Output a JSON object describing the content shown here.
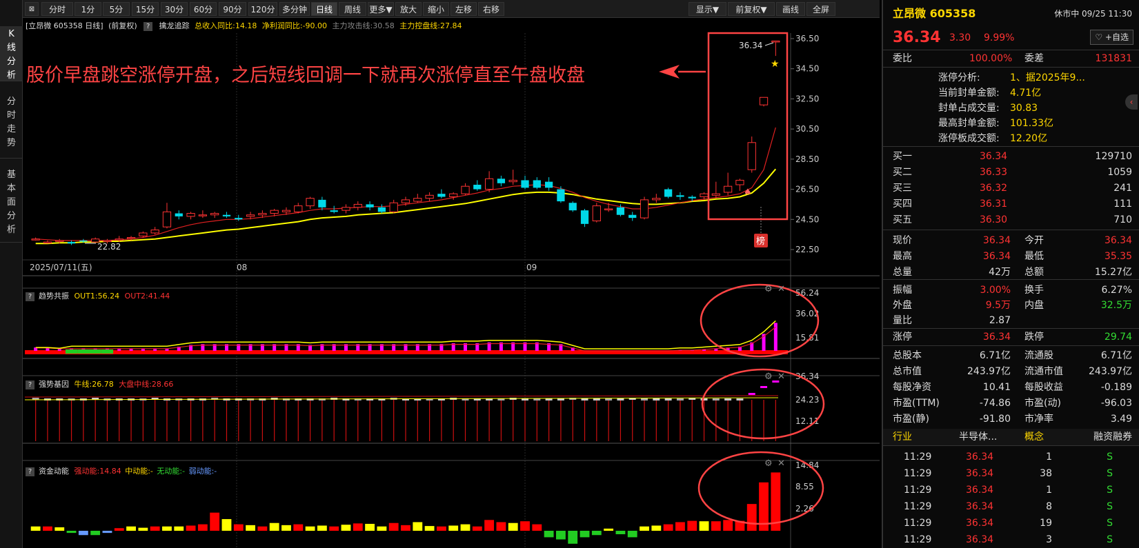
{
  "toolbar": {
    "buttons": [
      "分时",
      "1分",
      "5分",
      "15分",
      "30分",
      "60分",
      "90分",
      "120分",
      "多分钟",
      "日线",
      "周线",
      "更多▼",
      "放大",
      "缩小",
      "左移",
      "右移"
    ],
    "right_buttons": [
      "显示▼",
      "前复权▼",
      "画线",
      "全屏"
    ],
    "active": "日线"
  },
  "left_tabs": [
    "K\n线\n分\n析",
    "分\n时\n走\n势",
    "基\n本\n面\n分\n析"
  ],
  "info": {
    "symbol_tag": "[立昂微 605358 日线]",
    "adj": "(前复权)",
    "q": "?",
    "catch": "擒龙追踪",
    "income": "总收入同比:14.18",
    "profit": "净利润同比:-90.00",
    "attack": "主力攻击线:30.58",
    "control": "主力控盘线:27.84"
  },
  "chart": {
    "price_axis": [
      "36.50",
      "34.50",
      "32.50",
      "30.50",
      "28.50",
      "26.50",
      "24.50",
      "22.50"
    ],
    "dates": [
      "2025/07/11(五)",
      "08",
      "09"
    ],
    "low_label": "22.82",
    "high_label": "36.34",
    "annotation": "股价早盘跳空涨停开盘，之后短线回调一下就再次涨停直至午盘收盘",
    "bang": "榜"
  },
  "chart_data": {
    "type": "candlestick",
    "ylim": [
      22.0,
      37.0
    ],
    "ohlc": [
      [
        23.2,
        23.3,
        23.1,
        23.2
      ],
      [
        23.0,
        23.1,
        22.9,
        23.0
      ],
      [
        23.1,
        23.2,
        22.9,
        23.1
      ],
      [
        23.0,
        23.1,
        22.8,
        22.9
      ],
      [
        23.1,
        23.2,
        22.95,
        23.05
      ],
      [
        23.0,
        23.3,
        22.9,
        23.2
      ],
      [
        23.1,
        23.2,
        22.9,
        23.1
      ],
      [
        23.2,
        23.4,
        23.0,
        23.2
      ],
      [
        23.3,
        23.4,
        23.1,
        23.3
      ],
      [
        23.4,
        23.7,
        23.3,
        23.6
      ],
      [
        23.6,
        24.0,
        23.5,
        23.8
      ],
      [
        24.0,
        25.6,
        23.9,
        25.0
      ],
      [
        24.9,
        25.1,
        24.5,
        24.7
      ],
      [
        24.7,
        25.0,
        24.5,
        24.9
      ],
      [
        24.8,
        25.1,
        24.6,
        24.8
      ],
      [
        24.8,
        25.0,
        24.6,
        24.9
      ],
      [
        24.8,
        25.0,
        24.6,
        24.7
      ],
      [
        24.6,
        24.8,
        24.4,
        24.5
      ],
      [
        24.7,
        25.0,
        24.5,
        24.8
      ],
      [
        24.8,
        25.1,
        24.6,
        24.9
      ],
      [
        24.9,
        25.2,
        24.7,
        25.1
      ],
      [
        25.0,
        25.3,
        24.8,
        25.1
      ],
      [
        25.0,
        25.6,
        24.9,
        25.4
      ],
      [
        25.4,
        26.0,
        25.2,
        25.9
      ],
      [
        25.8,
        26.0,
        25.1,
        25.3
      ],
      [
        25.1,
        25.4,
        24.9,
        25.0
      ],
      [
        25.1,
        25.5,
        24.9,
        25.3
      ],
      [
        25.3,
        25.7,
        25.1,
        25.5
      ],
      [
        25.5,
        25.7,
        25.1,
        25.3
      ],
      [
        25.3,
        25.5,
        24.9,
        25.0
      ],
      [
        25.0,
        25.8,
        24.9,
        25.6
      ],
      [
        25.6,
        26.0,
        25.4,
        25.8
      ],
      [
        25.7,
        26.2,
        25.6,
        25.9
      ],
      [
        25.9,
        26.3,
        25.7,
        26.1
      ],
      [
        26.2,
        26.5,
        25.9,
        26.0
      ],
      [
        26.0,
        26.3,
        25.8,
        26.2
      ],
      [
        26.2,
        26.9,
        26.1,
        26.7
      ],
      [
        26.8,
        27.1,
        26.4,
        26.5
      ],
      [
        26.5,
        27.7,
        26.3,
        27.2
      ],
      [
        27.2,
        27.4,
        26.7,
        26.9
      ],
      [
        27.0,
        27.8,
        26.8,
        27.1
      ],
      [
        27.1,
        27.4,
        26.5,
        26.6
      ],
      [
        27.1,
        27.3,
        26.5,
        26.6
      ],
      [
        27.0,
        27.3,
        26.4,
        26.6
      ],
      [
        26.5,
        26.7,
        25.6,
        25.7
      ],
      [
        25.6,
        25.7,
        25.0,
        25.1
      ],
      [
        25.1,
        25.2,
        24.0,
        24.2
      ],
      [
        24.4,
        25.6,
        24.3,
        25.4
      ],
      [
        25.2,
        25.6,
        25.0,
        25.2
      ],
      [
        25.3,
        25.5,
        24.7,
        24.8
      ],
      [
        24.8,
        25.0,
        24.4,
        24.6
      ],
      [
        24.6,
        26.0,
        24.5,
        25.8
      ],
      [
        25.8,
        26.2,
        25.6,
        25.9
      ],
      [
        26.5,
        26.6,
        25.9,
        26.0
      ],
      [
        26.1,
        26.3,
        25.8,
        26.0
      ],
      [
        26.0,
        26.1,
        25.7,
        25.9
      ],
      [
        26.0,
        26.3,
        25.8,
        26.2
      ],
      [
        26.1,
        27.0,
        25.9,
        26.2
      ],
      [
        26.3,
        27.6,
        26.1,
        26.7
      ],
      [
        26.8,
        27.2,
        26.4,
        27.1
      ],
      [
        27.8,
        30.0,
        27.6,
        29.6
      ],
      [
        32.1,
        32.6,
        32.0,
        32.6
      ],
      [
        36.34,
        36.34,
        35.35,
        36.34
      ]
    ],
    "ma_short": [
      23.2,
      23.15,
      23.1,
      23.1,
      23.1,
      23.1,
      23.1,
      23.15,
      23.2,
      23.3,
      23.45,
      23.7,
      23.95,
      24.15,
      24.3,
      24.4,
      24.5,
      24.5,
      24.55,
      24.65,
      24.75,
      24.85,
      24.95,
      25.1,
      25.2,
      25.2,
      25.25,
      25.3,
      25.35,
      25.35,
      25.4,
      25.5,
      25.6,
      25.7,
      25.8,
      25.95,
      26.1,
      26.25,
      26.45,
      26.55,
      26.7,
      26.75,
      26.8,
      26.75,
      26.55,
      26.3,
      25.95,
      25.7,
      25.5,
      25.35,
      25.2,
      25.2,
      25.3,
      25.45,
      25.6,
      25.75,
      25.85,
      25.95,
      26.05,
      26.2,
      26.6,
      27.8,
      30.6
    ],
    "ma_long": [
      22.9,
      22.9,
      22.95,
      22.95,
      23.0,
      23.0,
      23.05,
      23.05,
      23.1,
      23.15,
      23.2,
      23.3,
      23.4,
      23.5,
      23.6,
      23.7,
      23.8,
      23.85,
      23.95,
      24.05,
      24.15,
      24.25,
      24.35,
      24.5,
      24.6,
      24.65,
      24.7,
      24.8,
      24.85,
      24.9,
      24.95,
      25.05,
      25.15,
      25.25,
      25.35,
      25.45,
      25.55,
      25.7,
      25.85,
      26.0,
      26.15,
      26.25,
      26.3,
      26.3,
      26.25,
      26.15,
      26.0,
      25.85,
      25.75,
      25.65,
      25.55,
      25.5,
      25.5,
      25.55,
      25.6,
      25.7,
      25.75,
      25.85,
      25.9,
      26.0,
      26.25,
      26.9,
      27.84
    ]
  },
  "ind1": {
    "q": "?",
    "name": "趋势共振",
    "out1": "OUT1:56.24",
    "out2": "OUT2:41.44",
    "axis": [
      "56.24",
      "36.02",
      "15.81"
    ],
    "values": [
      4,
      4,
      3,
      3,
      3,
      3,
      3,
      3,
      3,
      3,
      3,
      3,
      5,
      7,
      8,
      8,
      8,
      8,
      8,
      8,
      8,
      8,
      8,
      7,
      8,
      8,
      8,
      8,
      8,
      8,
      8,
      8,
      8,
      8,
      8,
      9,
      9,
      9,
      10,
      10,
      10,
      10,
      10,
      9,
      8,
      4,
      0,
      0,
      0,
      0,
      0,
      0,
      0,
      0,
      1,
      1,
      2,
      3,
      4,
      5,
      10,
      20,
      33,
      52,
      65
    ]
  },
  "ind2": {
    "q": "?",
    "name": "强势基因",
    "niu": "牛线:26.78",
    "dapan": "大盘中线:28.66",
    "axis": [
      "36.34",
      "24.23",
      "12.11"
    ]
  },
  "ind3": {
    "q": "?",
    "name": "资金动能",
    "strong": "强动能:14.84",
    "mid": "中动能:-",
    "none": "无动能:-",
    "weak": "弱动能:-",
    "axis": [
      "14.84",
      "8.55",
      "2.26"
    ],
    "values": [
      1,
      1,
      0.8,
      -0.5,
      -1,
      -1,
      -0.5,
      0.6,
      1,
      0.7,
      1,
      1,
      1,
      1.2,
      1.5,
      4.2,
      2.7,
      1.5,
      1.3,
      1,
      1.8,
      1.3,
      1.5,
      1,
      1.2,
      1,
      1.4,
      1.7,
      1.6,
      1,
      1.8,
      1.3,
      2,
      1.1,
      1,
      1.2,
      1.5,
      1,
      2.5,
      2,
      1.8,
      2.2,
      1.5,
      -1.5,
      -2,
      -3,
      -1.5,
      -1,
      0.5,
      -0.8,
      -1.5,
      1,
      1.2,
      1.5,
      2,
      2.3,
      2.2,
      2.2,
      2.5,
      2.3,
      6.2,
      11.2,
      13.5,
      14.84
    ]
  },
  "stock": {
    "name": "立昂微 605358",
    "status": "休市中 09/25 11:30",
    "price": "36.34",
    "change": "3.30",
    "pct": "9.99%",
    "watch": "♡ +自选"
  },
  "weibi": {
    "label": "委比",
    "val": "100.00%",
    "label2": "委差",
    "val2": "131831"
  },
  "limit": [
    {
      "k": "涨停分析:",
      "v": "1、据2025年9..."
    },
    {
      "k": "当前封单金额:",
      "v": "4.71亿"
    },
    {
      "k": "封单占成交量:",
      "v": "30.83"
    },
    {
      "k": "最高封单金额:",
      "v": "101.33亿"
    },
    {
      "k": "涨停板成交额:",
      "v": "12.20亿"
    }
  ],
  "bids": [
    {
      "k": "买一",
      "p": "36.34",
      "v": "129710"
    },
    {
      "k": "买二",
      "p": "36.33",
      "v": "1059"
    },
    {
      "k": "买三",
      "p": "36.32",
      "v": "241"
    },
    {
      "k": "买四",
      "p": "36.31",
      "v": "111"
    },
    {
      "k": "买五",
      "p": "36.30",
      "v": "710"
    }
  ],
  "quote": [
    {
      "k1": "现价",
      "v1": "36.34",
      "k2": "今开",
      "v2": "36.34"
    },
    {
      "k1": "最高",
      "v1": "36.34",
      "k2": "最低",
      "v2": "35.35"
    },
    {
      "k1": "总量",
      "v1": "42万",
      "k2": "总额",
      "v2": "15.27亿"
    }
  ],
  "quote2": [
    {
      "k1": "振幅",
      "v1": "3.00%",
      "k2": "换手",
      "v2": "6.27%"
    },
    {
      "k1": "外盘",
      "v1": "9.5万",
      "k2": "内盘",
      "v2": "32.5万"
    },
    {
      "k1": "量比",
      "v1": "2.87",
      "k2": "",
      "v2": ""
    }
  ],
  "limits": {
    "k1": "涨停",
    "v1": "36.34",
    "k2": "跌停",
    "v2": "29.74"
  },
  "fund": [
    {
      "k1": "总股本",
      "v1": "6.71亿",
      "k2": "流通股",
      "v2": "6.71亿"
    },
    {
      "k1": "总市值",
      "v1": "243.97亿",
      "k2": "流通市值",
      "v2": "243.97亿"
    },
    {
      "k1": "每股净资",
      "v1": "10.41",
      "k2": "每股收益",
      "v2": "-0.189"
    },
    {
      "k1": "市盈(TTM)",
      "v1": "-74.86",
      "k2": "市盈(动)",
      "v2": "-96.03"
    },
    {
      "k1": "市盈(静)",
      "v1": "-91.80",
      "k2": "市净率",
      "v2": "3.49"
    }
  ],
  "tags": [
    "行业",
    "半导体...",
    "概念",
    "融资融券"
  ],
  "ticks": [
    {
      "t": "11:29",
      "p": "36.34",
      "v": "1",
      "s": "S"
    },
    {
      "t": "11:29",
      "p": "36.34",
      "v": "38",
      "s": "S"
    },
    {
      "t": "11:29",
      "p": "36.34",
      "v": "1",
      "s": "S"
    },
    {
      "t": "11:29",
      "p": "36.34",
      "v": "8",
      "s": "S"
    },
    {
      "t": "11:29",
      "p": "36.34",
      "v": "19",
      "s": "S"
    },
    {
      "t": "11:29",
      "p": "36.34",
      "v": "3",
      "s": "S"
    }
  ],
  "colors": {
    "up": "#ff3333",
    "down": "#00d8e8",
    "ma_short": "#e02020",
    "ma_long": "#ffff00",
    "bar": "#ff00ff",
    "annot": "#ff4444"
  }
}
